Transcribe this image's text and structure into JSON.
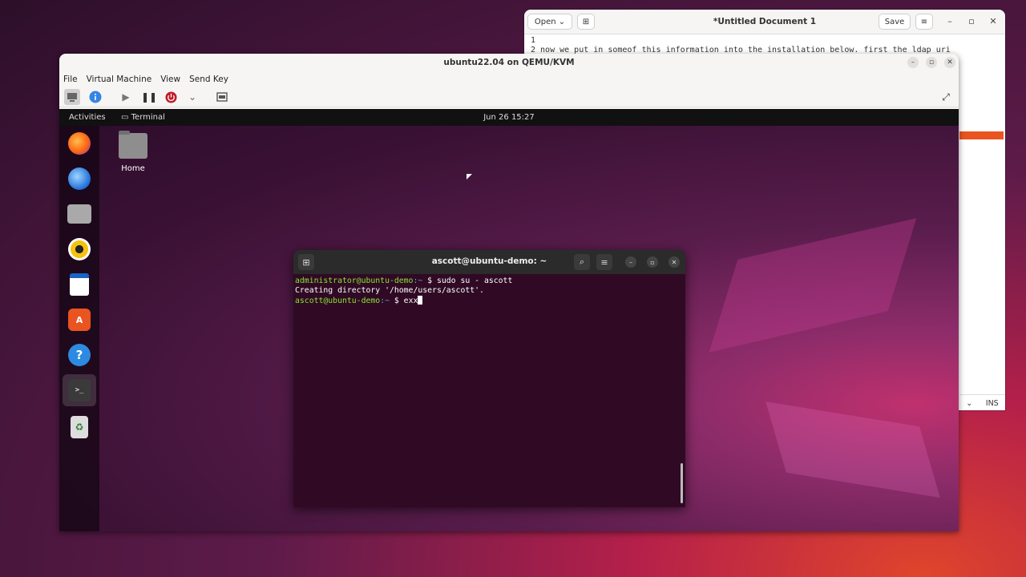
{
  "gedit": {
    "open_label": "Open",
    "title": "*Untitled Document 1",
    "save_label": "Save",
    "lines": [
      "1",
      "2 now we put in someof this information into the installation below. first the ldap uri"
    ],
    "status_mode": "INS"
  },
  "vm": {
    "title": "ubuntu22.04 on QEMU/KVM",
    "menu": [
      "File",
      "Virtual Machine",
      "View",
      "Send Key"
    ]
  },
  "guest": {
    "activities": "Activities",
    "app_name": "Terminal",
    "clock": "Jun 26  15:27",
    "home_label": "Home",
    "dock_apps": [
      "firefox-icon",
      "thunderbird-icon",
      "files-icon",
      "rhythmbox-icon",
      "writer-icon",
      "app-center-icon",
      "help-icon",
      "terminal-icon",
      "trash-icon"
    ]
  },
  "terminal": {
    "title": "ascott@ubuntu-demo: ~",
    "line1_user": "administrator@ubuntu-demo",
    "line1_path": ":~",
    "line1_cmd": "$ sudo su - ascott",
    "line2": "Creating directory '/home/users/ascott'.",
    "line3_user": "ascott@ubuntu-demo",
    "line3_path": ":~",
    "line3_cmd": "$ exx"
  },
  "colors": {
    "ubuntu_orange": "#e95420",
    "terminal_bg": "#300a24",
    "prompt_green": "#8ae234",
    "prompt_blue": "#729fcf"
  }
}
